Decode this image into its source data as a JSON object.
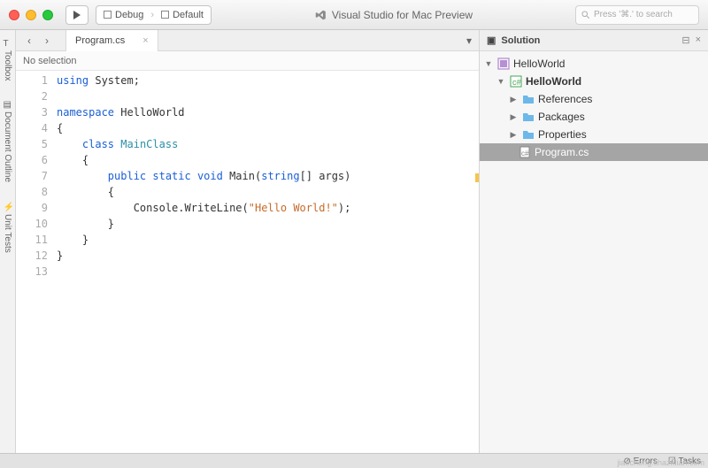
{
  "toolbar": {
    "config": {
      "debug": "Debug",
      "target": "Default"
    },
    "app_title": "Visual Studio for Mac Preview",
    "search_placeholder": "Press '⌘.' to search"
  },
  "left_rail": {
    "items": [
      "Toolbox",
      "Document Outline",
      "Unit Tests"
    ]
  },
  "editor": {
    "tab_name": "Program.cs",
    "crumb": "No selection",
    "line_numbers": [
      "1",
      "2",
      "3",
      "4",
      "5",
      "6",
      "7",
      "8",
      "9",
      "10",
      "11",
      "12",
      "13"
    ],
    "code": {
      "l1_kw": "using",
      "l1_ns": "System",
      "l3_kw": "namespace",
      "l3_id": "HelloWorld",
      "l5_kw": "class",
      "l5_id": "MainClass",
      "l7_mods": "public static void",
      "l7_name": "Main",
      "l7_type": "string",
      "l7_rest": "[] args)",
      "l9_call": "Console.WriteLine(",
      "l9_str": "\"Hello World!\"",
      "l9_end": ");"
    }
  },
  "solution": {
    "title": "Solution",
    "root": "HelloWorld",
    "project": "HelloWorld",
    "folders": [
      "References",
      "Packages",
      "Properties"
    ],
    "file": "Program.cs"
  },
  "statusbar": {
    "errors": "Errors",
    "tasks": "Tasks"
  },
  "watermark": "jiaocheng.chazidian.com"
}
